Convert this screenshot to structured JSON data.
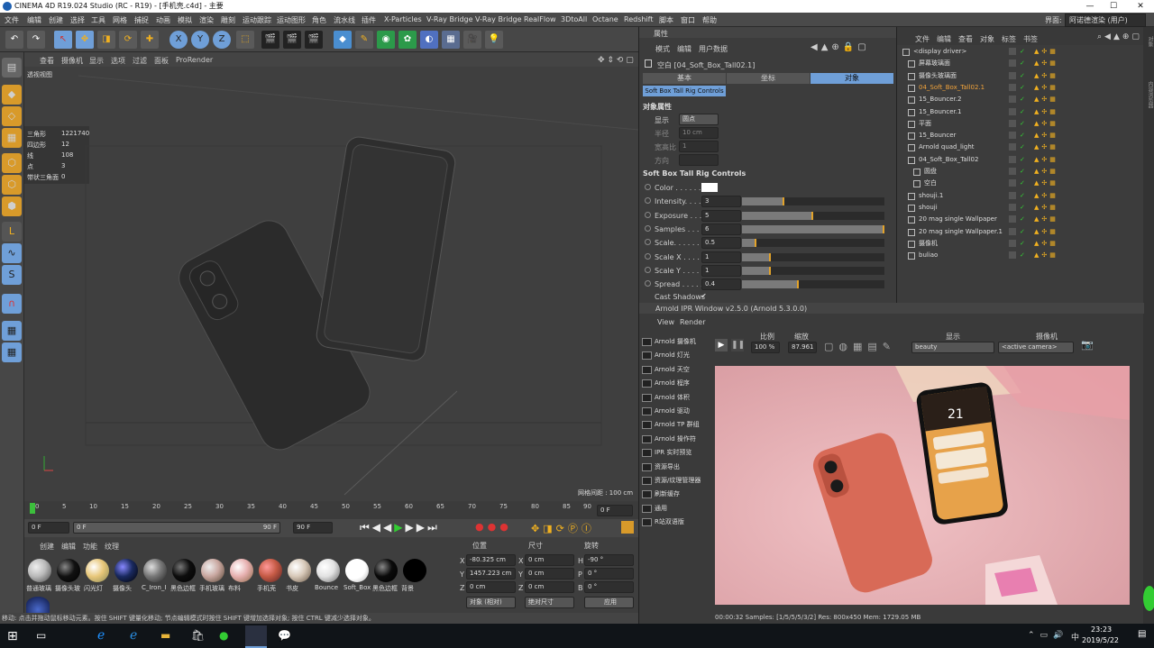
{
  "window": {
    "title": "CINEMA 4D R19.024 Studio (RC - R19) - [手机壳.c4d] - 主要",
    "min": "—",
    "max": "☐",
    "close": "✕"
  },
  "menu": [
    "文件",
    "编辑",
    "创建",
    "选择",
    "工具",
    "网格",
    "捕捉",
    "动画",
    "模拟",
    "渲染",
    "雕刻",
    "运动跟踪",
    "运动图形",
    "角色",
    "流水线",
    "插件",
    "X-Particles",
    "V-Ray Bridge",
    "V-Ray Bridge",
    "RealFlow",
    "3DtoAll",
    "Octane",
    "Redshift",
    "脚本",
    "窗口",
    "帮助"
  ],
  "layout": {
    "label": "界面:",
    "value": "阿诺德渲染 (用户)"
  },
  "viewport": {
    "menu": [
      "查看",
      "摄像机",
      "显示",
      "选项",
      "过滤",
      "面板",
      "ProRender"
    ],
    "name": "透视视图",
    "stats": [
      {
        "k": "三角形",
        "v": "1221740"
      },
      {
        "k": "四边形",
        "v": "12"
      },
      {
        "k": "线",
        "v": "108"
      },
      {
        "k": "点",
        "v": "3"
      },
      {
        "k": "带状三角面",
        "v": "0"
      }
    ],
    "grid": "网格间距 : 100 cm"
  },
  "timeline": {
    "ticks": [
      "0",
      "5",
      "10",
      "15",
      "20",
      "25",
      "30",
      "35",
      "40",
      "45",
      "50",
      "55",
      "60",
      "65",
      "70",
      "75",
      "80",
      "85",
      "90"
    ],
    "frame": "0 F"
  },
  "transport": {
    "start": "0 F",
    "min": "0 F",
    "max": "90 F",
    "end": "90 F"
  },
  "materials": {
    "menu": [
      "创建",
      "编辑",
      "功能",
      "纹理"
    ],
    "items": [
      {
        "name": "普通玻璃",
        "color": "#b9b9b9"
      },
      {
        "name": "摄像头玻",
        "color": "#111111"
      },
      {
        "name": "闪光灯",
        "color": "#e8c77a"
      },
      {
        "name": "摄像头",
        "color": "#1a2a60"
      },
      {
        "name": "C_Iron_I",
        "color": "#777777"
      },
      {
        "name": "黑色边框",
        "color": "#0d0d0d"
      },
      {
        "name": "手机玻璃",
        "color": "#c9a7a0"
      },
      {
        "name": "布料",
        "color": "#e7b0b0"
      },
      {
        "name": "手机壳",
        "color": "#c55a45"
      },
      {
        "name": "书皮",
        "color": "#d7c8b8"
      },
      {
        "name": "Bounce",
        "color": "#e2e2e2"
      },
      {
        "name": "Soft_Box",
        "color": "#ffffff"
      },
      {
        "name": "黑色边框",
        "color": "#0a0a0a"
      },
      {
        "name": "背景",
        "color": "#000000"
      }
    ]
  },
  "coords": {
    "headers": [
      "位置",
      "尺寸",
      "旋转"
    ],
    "rows": [
      {
        "a": "X",
        "pos": "-80.325 cm",
        "b": "X",
        "size": "0 cm",
        "c": "H",
        "rot": "-90 °"
      },
      {
        "a": "Y",
        "pos": "1457.223 cm",
        "b": "Y",
        "size": "0 cm",
        "c": "P",
        "rot": "0 °"
      },
      {
        "a": "Z",
        "pos": "0 cm",
        "b": "Z",
        "size": "0 cm",
        "c": "B",
        "rot": "0 °"
      }
    ],
    "mode": "对象 (相对)",
    "sizeMode": "绝对尺寸",
    "apply": "应用"
  },
  "status": "移动: 点击并拖动鼠标移动元素。按住 SHIFT 键量化移动; 节点编辑模式时按住 SHIFT 键增加选择对象; 按住 CTRL 键减少选择对象。",
  "attributes": {
    "header": "属性",
    "menu": [
      "模式",
      "编辑",
      "用户数据"
    ],
    "object": "空白 [04_Soft_Box_Tall02.1]",
    "tabs": [
      "基本",
      "坐标",
      "对象"
    ],
    "subtab": "Soft Box Tall Rig Controls",
    "section1": "对象属性",
    "display": {
      "label": "显示",
      "value": "圆点"
    },
    "radius": {
      "label": "半径",
      "value": "10 cm"
    },
    "aspect": {
      "label": "宽高比",
      "value": "1"
    },
    "orient": {
      "label": "方向",
      "value": ""
    },
    "section2": "Soft Box Tall Rig Controls",
    "params": [
      {
        "label": "Color . . . . . .",
        "value": "",
        "fraction": null
      },
      {
        "label": "Intensity. . . .",
        "value": "3",
        "fraction": 0.3
      },
      {
        "label": "Exposure . . .",
        "value": "5",
        "fraction": 0.5
      },
      {
        "label": "Samples . . . .",
        "value": "6",
        "fraction": 1.0
      },
      {
        "label": "Scale. . . . . . .",
        "value": "0.5",
        "fraction": 0.1
      },
      {
        "label": "Scale X . . . . .",
        "value": "1",
        "fraction": 0.2
      },
      {
        "label": "Scale Y . . . . .",
        "value": "1",
        "fraction": 0.2
      },
      {
        "label": "Spread . . . . .",
        "value": "0.4",
        "fraction": 0.4
      }
    ],
    "castShadows": "Cast Shadows"
  },
  "objects": {
    "menu": [
      "文件",
      "编辑",
      "查看",
      "对象",
      "标签",
      "书签"
    ],
    "items": [
      {
        "name": "<display driver>",
        "indent": 0,
        "color": "#ddd"
      },
      {
        "name": "屏幕玻璃面",
        "indent": 1,
        "color": "#ddd"
      },
      {
        "name": "摄像头玻璃面",
        "indent": 1,
        "color": "#ddd"
      },
      {
        "name": "04_Soft_Box_Tall02.1",
        "indent": 1,
        "color": "#f1a33b"
      },
      {
        "name": "15_Bouncer.2",
        "indent": 1,
        "color": "#ddd"
      },
      {
        "name": "15_Bouncer.1",
        "indent": 1,
        "color": "#ddd"
      },
      {
        "name": "平面",
        "indent": 1,
        "color": "#ddd"
      },
      {
        "name": "15_Bouncer",
        "indent": 1,
        "color": "#ddd"
      },
      {
        "name": "Arnold quad_light",
        "indent": 1,
        "color": "#ddd"
      },
      {
        "name": "04_Soft_Box_Tall02",
        "indent": 1,
        "color": "#ddd"
      },
      {
        "name": "圆盘",
        "indent": 2,
        "color": "#ddd"
      },
      {
        "name": "空白",
        "indent": 2,
        "color": "#ddd"
      },
      {
        "name": "shouji.1",
        "indent": 1,
        "color": "#ddd"
      },
      {
        "name": "shouji",
        "indent": 1,
        "color": "#ddd"
      },
      {
        "name": "20 mag single Wallpaper",
        "indent": 1,
        "color": "#ddd"
      },
      {
        "name": "20 mag single Wallpaper.1",
        "indent": 1,
        "color": "#ddd"
      },
      {
        "name": "摄像机",
        "indent": 1,
        "color": "#ddd"
      },
      {
        "name": "buliao",
        "indent": 1,
        "color": "#ddd"
      }
    ]
  },
  "ipr": {
    "title": "Arnold IPR Window v2.5.0 (Arnold 5.3.0.0)",
    "menu": [
      "View",
      "Render"
    ],
    "ratioLabel": "比例",
    "ratio": "100 %",
    "zoomLabel": "缩放",
    "zoom": "87.961",
    "displayLabel": "显示",
    "display": "beauty",
    "cameraLabel": "摄像机",
    "camera": "<active camera>",
    "buttons": [
      "Arnold 摄像机",
      "Arnold 灯光",
      "Arnold 天空",
      "Arnold 程序",
      "Arnold 体积",
      "Arnold 驱动",
      "Arnold TP 群组",
      "Arnold 操作符",
      "IPR 实时预览",
      "资源导出",
      "资源/纹理管理器",
      "刷新缓存",
      "通用",
      "R站双语版"
    ],
    "icons": [
      "📷",
      "💡",
      "☁",
      "▦",
      "▦",
      "▦",
      "▦",
      "OP",
      "IPR",
      "Ass",
      "TX",
      "▦",
      "▲",
      "▲"
    ],
    "statusbar": "00:00:32  Samples: [1/5/5/5/3/2]  Res: 800x450  Mem: 1729.05 MB",
    "phoneTime": "21"
  },
  "taskbar": {
    "time": "23:23",
    "date": "2019/5/22",
    "lang": "中"
  },
  "colors": {
    "accent": "#6f9fd8",
    "highlight": "#f1a33b",
    "case": "#d86a57",
    "bg": "#eab8bd"
  }
}
